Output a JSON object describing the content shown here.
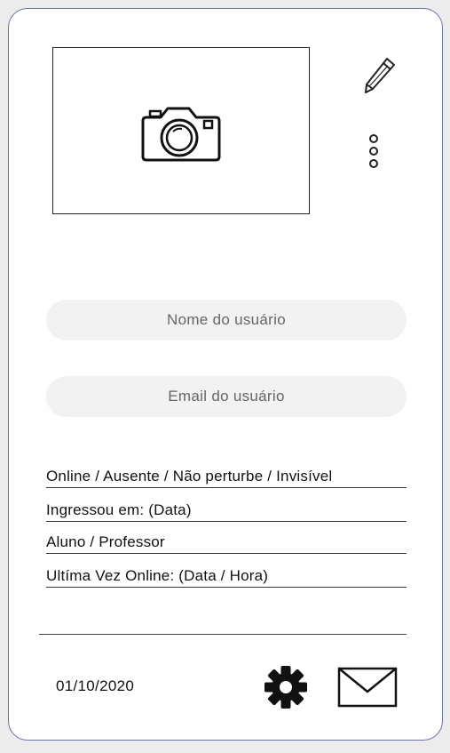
{
  "profile": {
    "photo_icon": "camera-icon",
    "edit_icon": "pencil-icon",
    "more_icon": "vertical-ellipsis-icon"
  },
  "fields": {
    "name_placeholder": "Nome do usuário",
    "email_placeholder": "Email do usuário"
  },
  "info": {
    "status": "Online / Ausente / Não perturbe / Invisível",
    "joined": "Ingressou em: (Data)",
    "role": "Aluno / Professor",
    "last_online": "Ultíma Vez Online: (Data / Hora)"
  },
  "footer": {
    "date": "01/10/2020",
    "settings_icon": "gear-icon",
    "mail_icon": "envelope-icon"
  },
  "colors": {
    "card_border": "#6a6fb0",
    "field_bg": "#f2f2f2",
    "page_bg": "#ececec"
  }
}
